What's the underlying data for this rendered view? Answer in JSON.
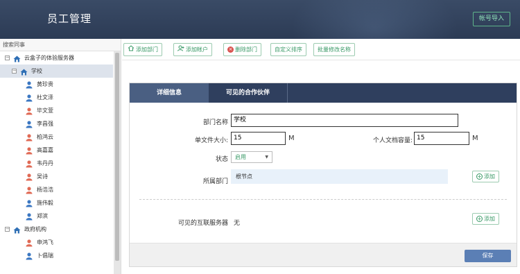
{
  "header": {
    "title": "员工管理",
    "import_label": "帐号导入"
  },
  "sidebar": {
    "search_label": "搜索同事",
    "nodes": [
      {
        "label": "云盒子的体验服务器",
        "kind": "org",
        "toggle": "⊟"
      },
      {
        "label": "学校",
        "kind": "dept",
        "toggle": "⊟"
      },
      {
        "label": "黄珍贵",
        "kind": "person-blue"
      },
      {
        "label": "杜文泽",
        "kind": "person-blue"
      },
      {
        "label": "毕文萱",
        "kind": "person-red"
      },
      {
        "label": "李昌强",
        "kind": "person-blue"
      },
      {
        "label": "柏鸿云",
        "kind": "person-red"
      },
      {
        "label": "高嘉嘉",
        "kind": "person-red"
      },
      {
        "label": "韦丹丹",
        "kind": "person-red"
      },
      {
        "label": "吴诗",
        "kind": "person-red"
      },
      {
        "label": "杨浩浩",
        "kind": "person-red"
      },
      {
        "label": "施伟毅",
        "kind": "person-blue"
      },
      {
        "label": "郑滨",
        "kind": "person-blue"
      },
      {
        "label": "政府机构",
        "kind": "dept",
        "toggle": "⊟"
      },
      {
        "label": "申鸿飞",
        "kind": "person-red"
      },
      {
        "label": "卜倡瑞",
        "kind": "person-blue"
      }
    ]
  },
  "toolbar": {
    "add_dept": "添加部门",
    "add_account": "添加帐户",
    "delete_dept": "删除部门",
    "custom_sort": "自定义排序",
    "batch_rename": "批量修改名称"
  },
  "tabs": {
    "details": "详细信息",
    "partners": "可见的合作伙伴"
  },
  "form": {
    "dept_name_label": "部门名称",
    "dept_name_value": "学校",
    "file_size_label": "单文件大小:",
    "file_size_value": "15",
    "file_size_unit": "M",
    "quota_label": "个人文档容量:",
    "quota_value": "15",
    "quota_unit": "M",
    "status_label": "状态",
    "status_value": "启用",
    "parent_label": "所属部门",
    "parent_value": "根节点",
    "add_label": "添加",
    "servers_label": "可见的互联服务器",
    "servers_value": "无",
    "add_label_2": "添加",
    "save_label": "保存"
  },
  "colors": {
    "header": "#2f3f5e",
    "accent_green": "#3a9a67",
    "save_blue": "#5b7fb5",
    "delete_red": "#d9534f"
  }
}
